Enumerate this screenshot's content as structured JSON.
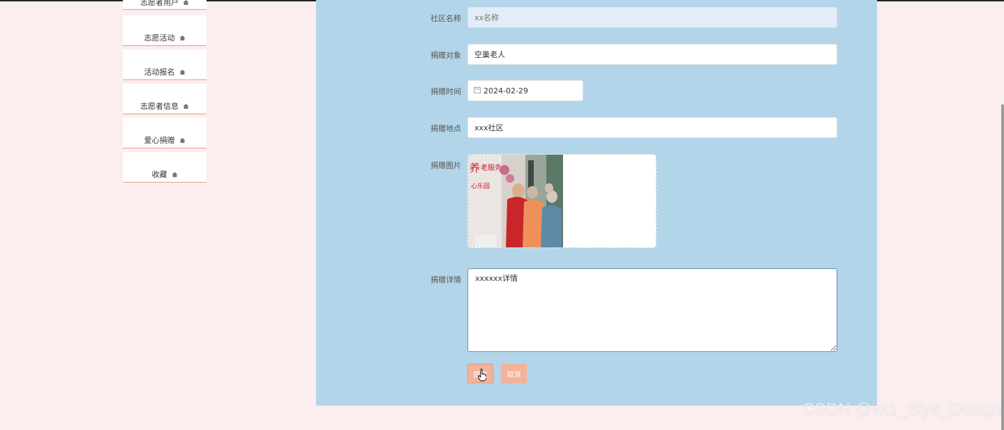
{
  "sidebar": {
    "items": [
      {
        "label": "志愿者用户",
        "icon": "home-icon"
      },
      {
        "label": "志愿活动",
        "icon": "home-icon"
      },
      {
        "label": "活动报名",
        "icon": "home-icon"
      },
      {
        "label": "志愿者信息",
        "icon": "home-icon"
      },
      {
        "label": "爱心捐赠",
        "icon": "home-icon"
      },
      {
        "label": "收藏",
        "icon": "home-icon"
      }
    ]
  },
  "form": {
    "community_name": {
      "label": "社区名称",
      "placeholder": "xx名称",
      "value": ""
    },
    "donation_target": {
      "label": "捐赠对象",
      "value": "空巢老人"
    },
    "donation_time": {
      "label": "捐赠时间",
      "value": "2024-02-29",
      "icon": "calendar-icon"
    },
    "donation_place": {
      "label": "捐赠地点",
      "value": "xxx社区"
    },
    "donation_image": {
      "label": "捐赠图片"
    },
    "donation_detail": {
      "label": "捐赠详情",
      "value": "xxxxxx详情"
    },
    "submit_label": "提交",
    "cancel_label": "取消"
  },
  "watermark": "CSDN @vx1_Biye_Design",
  "colors": {
    "page_bg": "#fcedee",
    "panel_bg": "#b3d5e9",
    "button_bg": "#f2b39a",
    "sidebar_border": "#ef9a8e"
  }
}
